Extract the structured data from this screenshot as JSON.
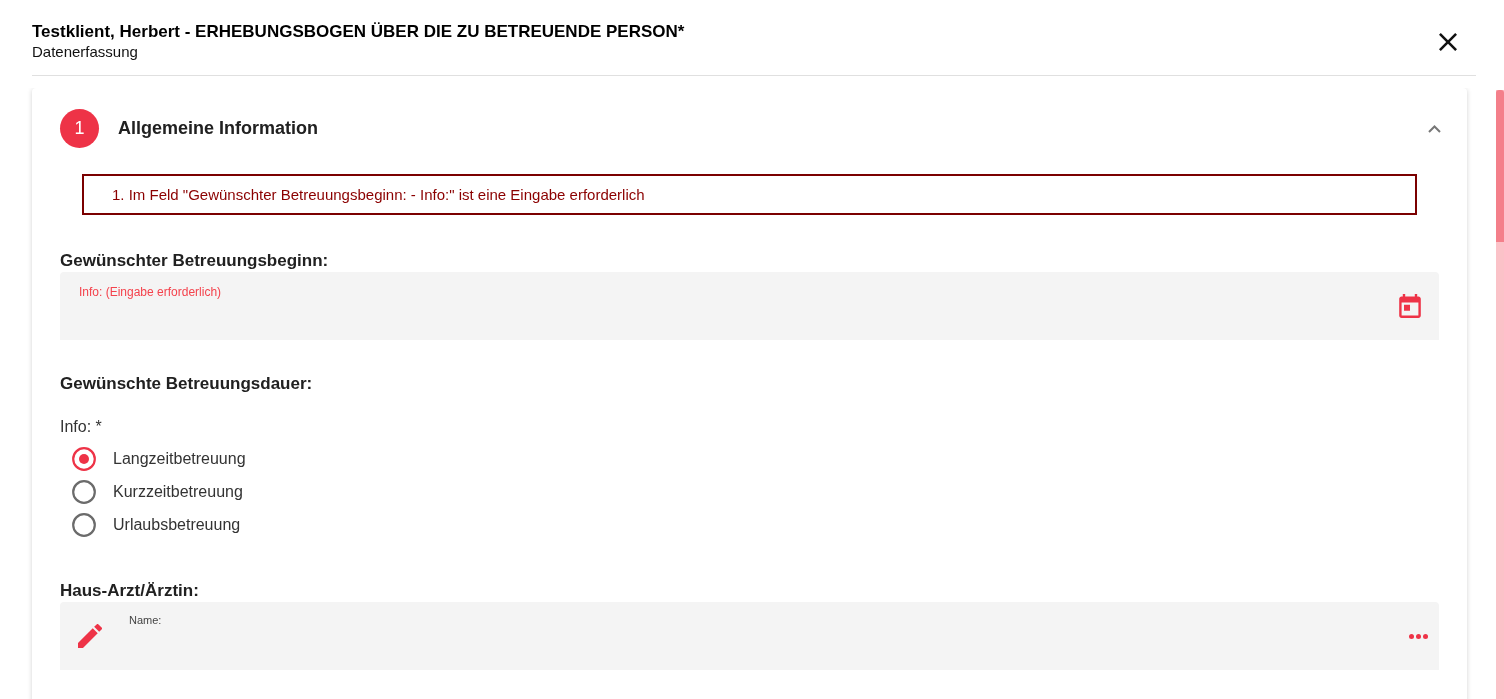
{
  "dialog": {
    "title": "Testklient, Herbert - ERHEBUNGSBOGEN ÜBER DIE ZU BETREUENDE PERSON*",
    "subtitle": "Datenerfassung"
  },
  "section": {
    "number": "1",
    "title": "Allgemeine Information",
    "expanded": true,
    "errors": [
      "1. Im Feld \"Gewünschter Betreuungsbeginn: - Info:\" ist eine Eingabe erforderlich"
    ],
    "fields": [
      {
        "kind": "date",
        "heading": "Gewünschter Betreuungsbeginn:",
        "label": "Info: (Eingabe erforderlich)",
        "invalid": true
      },
      {
        "kind": "radio",
        "heading": "Gewünschte Betreuungsdauer:",
        "label": "Info: *",
        "options": [
          {
            "label": "Langzeitbetreuung",
            "selected": true
          },
          {
            "label": "Kurzzeitbetreuung",
            "selected": false
          },
          {
            "label": "Urlaubsbetreuung",
            "selected": false
          }
        ]
      },
      {
        "kind": "lookup",
        "heading": "Haus-Arzt/Ärztin:",
        "label": "Name:"
      }
    ]
  }
}
